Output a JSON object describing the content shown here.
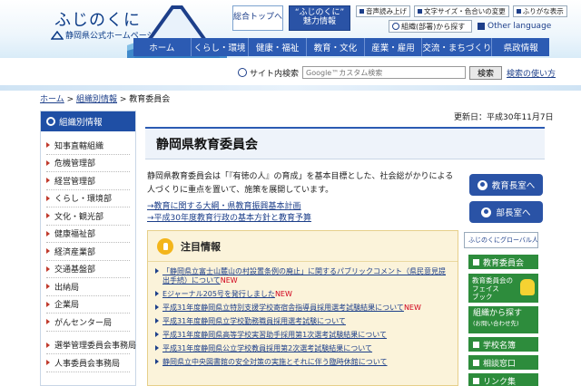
{
  "header": {
    "logo_title": "ふじのくに",
    "logo_sub": "静岡県公式ホームページ",
    "top_button": "総合トップへ",
    "charm_button_line1": "“ふじのくに”",
    "charm_button_line2": "魅力情報",
    "util": {
      "read_aloud": "音声読み上げ",
      "font_color": "文字サイズ・色合いの変更",
      "furigana": "ふりがな表示"
    },
    "org_search": "組織(部署)から探す",
    "english": "Other language"
  },
  "gnav": {
    "items": [
      "ホーム",
      "くらし・環境",
      "健康・福祉",
      "教育・文化",
      "産業・雇用",
      "交流・まちづくり",
      "県政情報"
    ]
  },
  "search": {
    "label": "サイト内検索",
    "placeholder": "Google™カスタム検索",
    "button": "検索",
    "how": "検索の使い方"
  },
  "breadcrumb": {
    "home": "ホーム",
    "sep": " > ",
    "org": "組織別情報",
    "current": "教育委員会"
  },
  "updated": "更新日：平成30年11月7日",
  "sidebar": {
    "title": "組織別情報",
    "items": [
      "知事直轄組織",
      "危機管理部",
      "経営管理部",
      "くらし・環境部",
      "文化・観光部",
      "健康福祉部",
      "経済産業部",
      "交通基盤部",
      "出納局",
      "企業局",
      "がんセンター局",
      "選挙管理委員会事務局",
      "人事委員会事務局"
    ]
  },
  "main": {
    "title": "静岡県教育委員会",
    "intro": "静岡県教育委員会は「『有徳の人』の育成」を基本目標とした、社会総がかりによる人づくりに重点を置いて、施策を展開しています。",
    "links": [
      "→教育に関する大綱・県教育振興基本計画",
      "→平成30年度教育行政の基本方針と教育予算"
    ],
    "notice": {
      "title": "注目情報",
      "items": [
        {
          "text": "「静岡県立富士山麓山の村設置条例の廃止」に関するパブリックコメント（県民意見提出手続）について",
          "new": "NEW"
        },
        {
          "text": "Eジャーナル205号を発行しました",
          "new": "NEW"
        },
        {
          "text": "平成31年度静岡県立特別支援学校寄宿舎指導員採用選考試験結果について",
          "new": "NEW"
        },
        {
          "text": "平成31年度静岡県立学校勤務職員採用選考試験について",
          "new": ""
        },
        {
          "text": "平成31年度静岡県高等学校実習助手採用第1次選考試験結果について",
          "new": ""
        },
        {
          "text": "平成31年度静岡県公立学校教員採用第2次選考試験結果について",
          "new": ""
        },
        {
          "text": "静岡県立中央図書館の安全対策の実施とそれに伴う臨時休館について",
          "new": ""
        }
      ]
    }
  },
  "right": {
    "superintendent": "教育長室へ",
    "director": "部長室へ",
    "global_banner": "ふじのくにグローバル人材育成基金",
    "board": "教育委員会",
    "facebook_line1": "教育委員会の",
    "facebook_line2": "フェイス",
    "facebook_line3": "ブック",
    "find_line1": "組織から探す",
    "find_line2": "(お問い合わせ先)",
    "school_list": "学校名簿",
    "consult": "相談窓口",
    "links": "リンク集"
  },
  "colors": {
    "nav_blue": "#2c5bb3",
    "link_blue": "#1d3f8a",
    "green": "#2d8c3c",
    "new_red": "#d0011b",
    "notice_bg": "#fbf3da"
  }
}
